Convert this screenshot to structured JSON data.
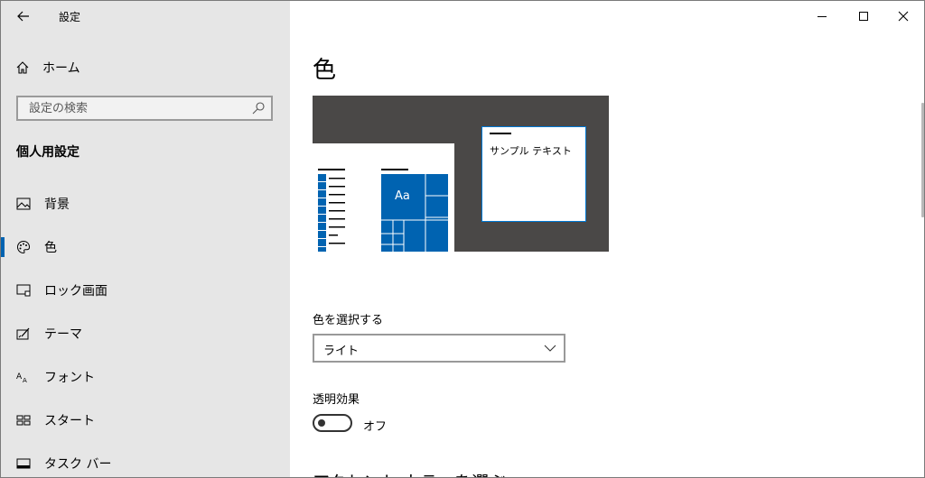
{
  "window": {
    "app_title": "設定",
    "back_icon": "back-arrow-icon",
    "controls": [
      "minimize-icon",
      "maximize-icon",
      "close-icon"
    ]
  },
  "sidebar": {
    "home_label": "ホーム",
    "home_icon": "home-icon",
    "search_placeholder": "設定の検索",
    "section_title": "個人用設定",
    "items": [
      {
        "label": "背景",
        "icon": "image-icon",
        "selected": false
      },
      {
        "label": "色",
        "icon": "palette-icon",
        "selected": true
      },
      {
        "label": "ロック画面",
        "icon": "lock-screen-icon",
        "selected": false
      },
      {
        "label": "テーマ",
        "icon": "theme-icon",
        "selected": false
      },
      {
        "label": "フォント",
        "icon": "font-icon",
        "selected": false
      },
      {
        "label": "スタート",
        "icon": "start-icon",
        "selected": false
      },
      {
        "label": "タスク バー",
        "icon": "taskbar-icon",
        "selected": false
      }
    ],
    "accent_color": "#0063b1",
    "background": "#e6e6e6"
  },
  "main": {
    "title": "色",
    "preview": {
      "sample_text": "サンプル テキスト",
      "tile_text": "Aa",
      "tile_color": "#0063b1",
      "background": "#4a4847"
    },
    "choose_color_label": "色を選択する",
    "choose_color_value": "ライト",
    "transparency_label": "透明効果",
    "transparency_state": "オフ",
    "accent_heading": "アクセント カラーを選ぶ"
  }
}
